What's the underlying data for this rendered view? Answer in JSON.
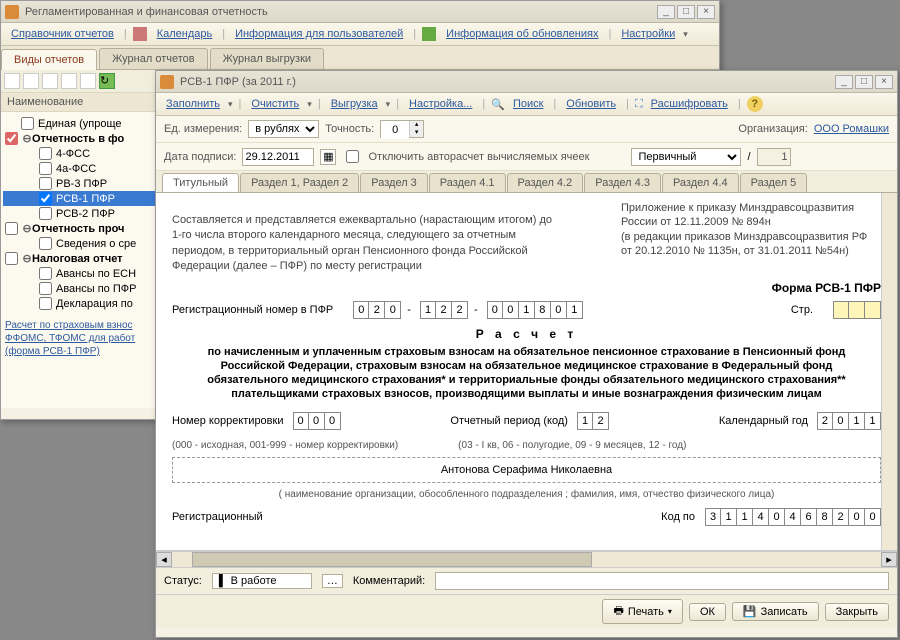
{
  "win1": {
    "title": "Регламентированная и финансовая отчетность",
    "toolbar": {
      "ref": "Справочник отчетов",
      "cal": "Календарь",
      "info": "Информация для пользователей",
      "upd": "Информация об обновлениях",
      "settings": "Настройки"
    },
    "main_tabs": {
      "types": "Виды отчетов",
      "journal": "Журнал отчетов",
      "upload": "Журнал выгрузки"
    },
    "side_head": "Наименование",
    "tree": {
      "i0": "Единая (упроще",
      "i1": "Отчетность в фо",
      "i2": "4-ФСС",
      "i3": "4а-ФСС",
      "i4": "РВ-3 ПФР",
      "i5": "РСВ-1 ПФР",
      "i6": "РСВ-2 ПФР",
      "i7": "Отчетность проч",
      "i8": "Сведения о сре",
      "i9": "Налоговая отчет",
      "i10": "Авансы по ЕСН",
      "i11": "Авансы по ПФР",
      "i12": "Декларация по"
    },
    "tree_link": "Расчет по страховым взнос\nФФОМС, ТФОМС для работ\n(форма РСВ-1 ПФР)"
  },
  "win2": {
    "title": "РСВ-1 ПФР (за 2011 г.)",
    "toolbar": {
      "fill": "Заполнить",
      "clear": "Очистить",
      "upload": "Выгрузка",
      "settings": "Настройка...",
      "search": "Поиск",
      "refresh": "Обновить",
      "decode": "Расшифровать"
    },
    "params": {
      "unit_lbl": "Ед. измерения:",
      "unit_val": "в рублях",
      "prec_lbl": "Точность:",
      "prec_val": "0",
      "org_lbl": "Организация:",
      "org_val": "ООО Ромашки",
      "date_lbl": "Дата подписи:",
      "date_val": "29.12.2011",
      "autocalc": "Отключить авторасчет вычисляемых ячеек",
      "type_val": "Первичный",
      "slash": "/",
      "copy_val": "1"
    },
    "doctabs": {
      "t0": "Титульный",
      "t1": "Раздел 1, Раздел 2",
      "t2": "Раздел 3",
      "t3": "Раздел 4.1",
      "t4": "Раздел 4.2",
      "t5": "Раздел 4.3",
      "t6": "Раздел 4.4",
      "t7": "Раздел 5"
    },
    "doc": {
      "intro": "Составляется и представляется ежеквартально (нарастающим итогом) до 1-го числа второго календарного месяца, следующего за отчетным периодом, в территориальный орган Пенсионного фонда Российской Федерации (далее – ПФР)  по месту регистрации",
      "appx1": "Приложение к приказу Минздравсоцразвития России от 12.11.2009 № 894н",
      "appx2": "(в редакции приказов Минздравсоцразвития РФ от 20.12.2010 № 1135н, от 31.01.2011 №54н)",
      "form_lbl": "Форма РСВ-1 ПФР",
      "regnum_lbl": "Регистрационный номер в ПФР",
      "regnum_d": [
        "0",
        "2",
        "0",
        "1",
        "2",
        "2",
        "0",
        "0",
        "1",
        "8",
        "0",
        "1"
      ],
      "page_lbl": "Стр.",
      "calc_title": "Р а с ч е т",
      "calc_body": "по начисленным и уплаченным страховым взносам на обязательное пенсионное страхование  в Пенсионный фонд Российской Федерации, страховым взносам на обязательное медицинское страхование в Федеральный фонд обязательного медицинского страхования*  и территориальные фонды обязательного медицинского страхования** плательщиками страховых взносов, производящими выплаты и иные вознаграждения физическим лицам",
      "corr_lbl": "Номер корректировки",
      "corr_d": [
        "0",
        "0",
        "0"
      ],
      "corr_note": "(000 - исходная, 001-999 - номер корректировки)",
      "period_lbl": "Отчетный период (код)",
      "period_d": [
        "1",
        "2"
      ],
      "period_note": "(03 - I кв, 06 - полугодие, 09 - 9 месяцев, 12 - год)",
      "year_lbl": "Календарный год",
      "year_d": [
        "2",
        "0",
        "1",
        "1"
      ],
      "name_val": "Антонова Серафима Николаевна",
      "name_note": "( наименование организации, обособленного подразделения ; фамилия, имя, отчество физического лица)",
      "reg_lbl2": "Регистрационный",
      "code_lbl": "Код по",
      "code_d": [
        "3",
        "1",
        "1",
        "4",
        "0",
        "4",
        "6",
        "8",
        "2",
        "0",
        "0"
      ]
    },
    "status": {
      "lbl": "Статус:",
      "val": "В работе",
      "comment_lbl": "Комментарий:"
    },
    "buttons": {
      "print": "Печать",
      "ok": "ОК",
      "save": "Записать",
      "close": "Закрыть"
    }
  }
}
